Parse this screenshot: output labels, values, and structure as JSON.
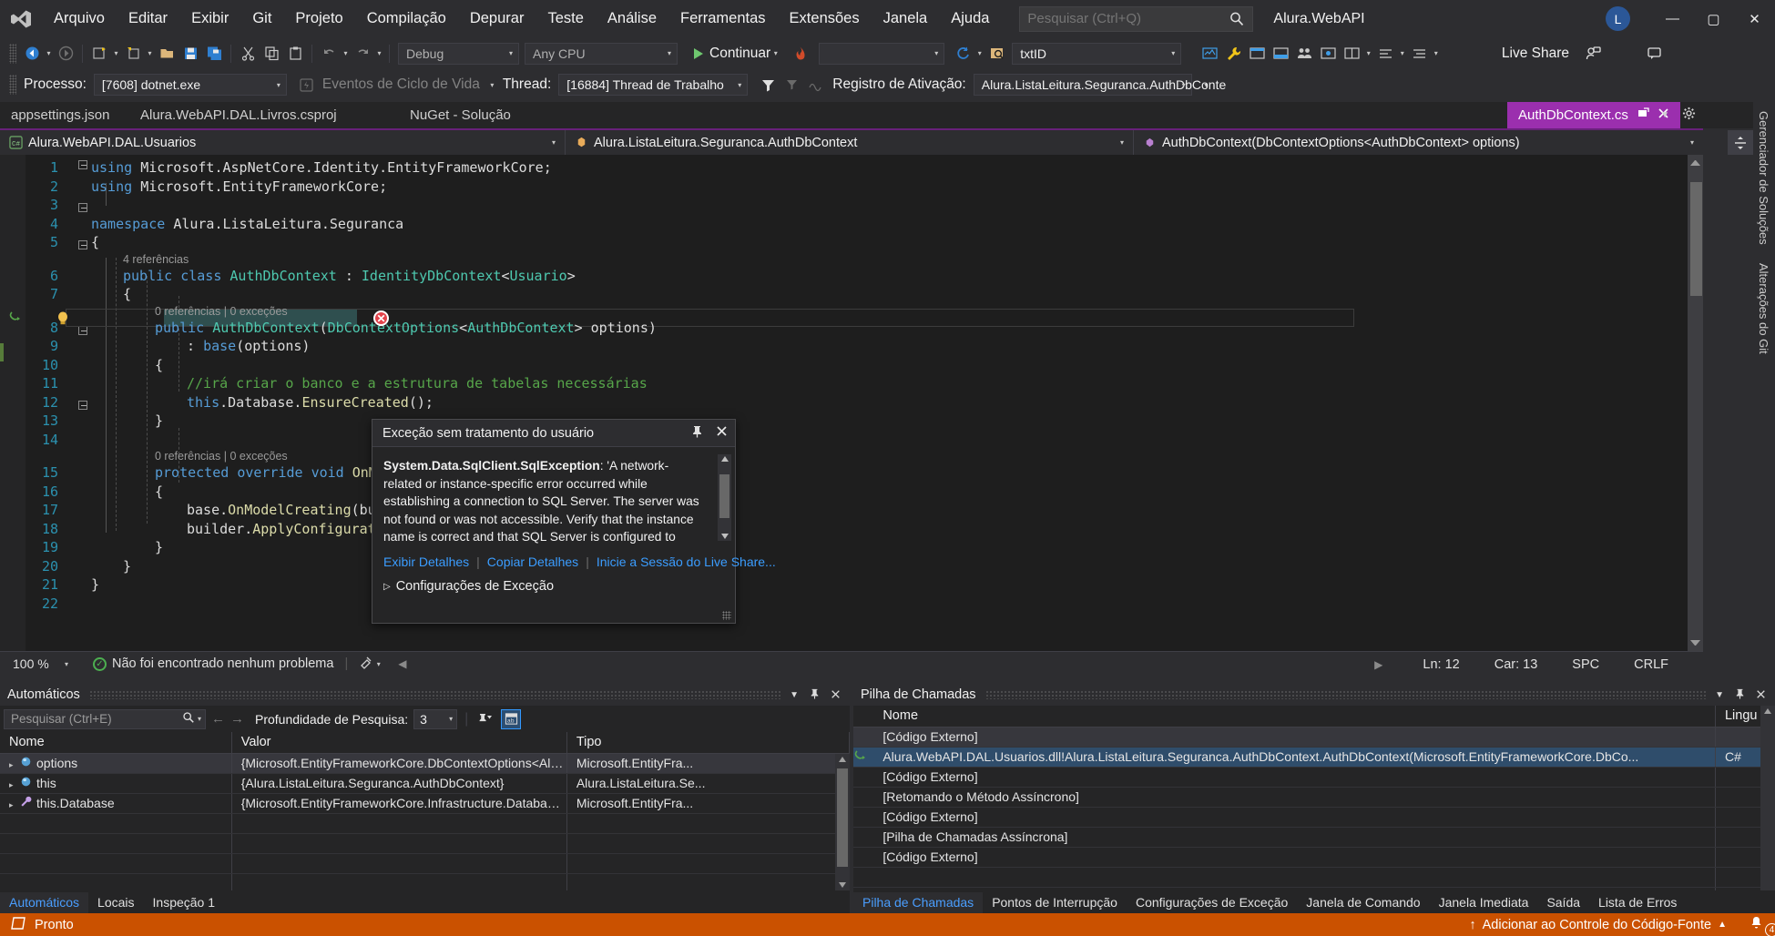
{
  "window": {
    "solution_name": "Alura.WebAPI",
    "account_initial": "L",
    "minimize": "—",
    "maximize": "▢",
    "close": "✕"
  },
  "menu": {
    "items": [
      "Arquivo",
      "Editar",
      "Exibir",
      "Git",
      "Projeto",
      "Compilação",
      "Depurar",
      "Teste",
      "Análise",
      "Ferramentas",
      "Extensões",
      "Janela",
      "Ajuda"
    ]
  },
  "search": {
    "placeholder": "Pesquisar (Ctrl+Q)",
    "value": ""
  },
  "toolbar1": {
    "config_combo": "Debug",
    "platform_combo": "Any CPU",
    "run_label": "Continuar",
    "empty_combo": "",
    "target_combo": "txtID",
    "live_share": "Live Share"
  },
  "toolbar2": {
    "process_label": "Processo:",
    "process_value": "[7608] dotnet.exe",
    "lifecycle_events": "Eventos de Ciclo de Vida",
    "thread_label": "Thread:",
    "thread_value": "[16884] Thread de Trabalho",
    "stack_frame_label": "Registro de Ativação:",
    "stack_frame_value": "Alura.ListaLeitura.Seguranca.AuthDbConte"
  },
  "doc_tabs": [
    {
      "label": "appsettings.json",
      "active": false
    },
    {
      "label": "Alura.WebAPI.DAL.Livros.csproj",
      "active": false
    },
    {
      "label": "NuGet - Solução",
      "active": false
    },
    {
      "label": "AuthDbContext.cs",
      "active": true
    }
  ],
  "navbar": {
    "project": "Alura.WebAPI.DAL.Usuarios",
    "type": "Alura.ListaLeitura.Seguranca.AuthDbContext",
    "member": "AuthDbContext(DbContextOptions<AuthDbContext> options)"
  },
  "code": {
    "lines": [
      {
        "n": 1,
        "tokens": [
          [
            "kw",
            "using "
          ],
          [
            "plain",
            "Microsoft.AspNetCore.Identity.EntityFrameworkCore;"
          ]
        ],
        "indent": 0
      },
      {
        "n": 2,
        "tokens": [
          [
            "kw",
            "using "
          ],
          [
            "plain",
            "Microsoft.EntityFrameworkCore;"
          ]
        ],
        "indent": 0
      },
      {
        "n": 3,
        "tokens": [],
        "indent": 0
      },
      {
        "n": 4,
        "tokens": [
          [
            "kw",
            "namespace "
          ],
          [
            "plain",
            "Alura.ListaLeitura.Seguranca"
          ]
        ],
        "indent": 0
      },
      {
        "n": 5,
        "tokens": [
          [
            "plain",
            "{"
          ]
        ],
        "indent": 0
      },
      {
        "n": 6,
        "tokens": [
          [
            "kw",
            "public "
          ],
          [
            "kw",
            "class "
          ],
          [
            "typ",
            "AuthDbContext"
          ],
          [
            "plain",
            " : "
          ],
          [
            "typ",
            "IdentityDbContext"
          ],
          [
            "plain",
            "<"
          ],
          [
            "typ",
            "Usuario"
          ],
          [
            "plain",
            ">"
          ]
        ],
        "indent": 1,
        "lens": "4 referências"
      },
      {
        "n": 7,
        "tokens": [
          [
            "plain",
            "{"
          ]
        ],
        "indent": 1
      },
      {
        "n": 8,
        "tokens": [
          [
            "kw",
            "public "
          ],
          [
            "typ",
            "AuthDbContext"
          ],
          [
            "plain",
            "("
          ],
          [
            "typ",
            "DbContextOptions"
          ],
          [
            "plain",
            "<"
          ],
          [
            "typ",
            "AuthDbContext"
          ],
          [
            "plain",
            "> options)"
          ]
        ],
        "indent": 2,
        "lens": "0 referências | 0 exceções"
      },
      {
        "n": 9,
        "tokens": [
          [
            "plain",
            ": "
          ],
          [
            "kw",
            "base"
          ],
          [
            "plain",
            "(options)"
          ]
        ],
        "indent": 3
      },
      {
        "n": 10,
        "tokens": [
          [
            "plain",
            "{"
          ]
        ],
        "indent": 2
      },
      {
        "n": 11,
        "tokens": [
          [
            "cmt",
            "//irá criar o banco e a estrutura de tabelas necessárias"
          ]
        ],
        "indent": 3
      },
      {
        "n": 12,
        "tokens": [
          [
            "kw",
            "this"
          ],
          [
            "plain",
            ".Database."
          ],
          [
            "mth",
            "EnsureCreated"
          ],
          [
            "plain",
            "();"
          ]
        ],
        "indent": 3,
        "current": true
      },
      {
        "n": 13,
        "tokens": [
          [
            "plain",
            "}"
          ]
        ],
        "indent": 2
      },
      {
        "n": 14,
        "tokens": [],
        "indent": 0
      },
      {
        "n": 15,
        "tokens": [
          [
            "kw",
            "protected "
          ],
          [
            "kw",
            "override "
          ],
          [
            "kw",
            "void "
          ],
          [
            "mth",
            "OnModelCrea"
          ]
        ],
        "indent": 2,
        "lens": "0 referências | 0 exceções",
        "clipped": true
      },
      {
        "n": 16,
        "tokens": [
          [
            "plain",
            "{"
          ]
        ],
        "indent": 2
      },
      {
        "n": 17,
        "tokens": [
          [
            "plain",
            "base."
          ],
          [
            "mth",
            "OnModelCreating"
          ],
          [
            "plain",
            "(builder);"
          ]
        ],
        "indent": 3
      },
      {
        "n": 18,
        "tokens": [
          [
            "plain",
            "builder."
          ],
          [
            "mth",
            "ApplyConfiguration"
          ],
          [
            "plain",
            "<"
          ],
          [
            "typ",
            "Usua"
          ]
        ],
        "indent": 3,
        "clipped": true
      },
      {
        "n": 19,
        "tokens": [
          [
            "plain",
            "}"
          ]
        ],
        "indent": 2
      },
      {
        "n": 20,
        "tokens": [
          [
            "plain",
            "}"
          ]
        ],
        "indent": 1
      },
      {
        "n": 21,
        "tokens": [
          [
            "plain",
            "}"
          ]
        ],
        "indent": 0
      },
      {
        "n": 22,
        "tokens": [],
        "indent": 0
      }
    ]
  },
  "exception": {
    "title": "Exceção sem tratamento do usuário",
    "type": "System.Data.SqlClient.SqlException",
    "message": ": 'A network-related or instance-specific error occurred while establishing a connection to SQL Server. The server was not found or was not accessible. Verify that the instance name is correct and that SQL Server is configured to allow remote connections. (provider: SQL Network Interfaces,",
    "links": [
      "Exibir Detalhes",
      "Copiar Detalhes",
      "Inicie a Sessão do Live Share..."
    ],
    "settings_label": "Configurações de Exceção",
    "pin_icon": "pin",
    "close_icon": "✕"
  },
  "editor_status": {
    "zoom": "100 %",
    "problems": "Não foi encontrado nenhum problema",
    "line": "Ln: 12",
    "column": "Car: 13",
    "spaces": "SPC",
    "eol": "CRLF"
  },
  "right_tabs": [
    "Gerenciador de Soluções",
    "Alterações do Git"
  ],
  "autos": {
    "title": "Automáticos",
    "search_placeholder": "Pesquisar (Ctrl+E)",
    "depth_label": "Profundidade de Pesquisa:",
    "depth_value": "3",
    "columns": [
      "Nome",
      "Valor",
      "Tipo"
    ],
    "rows": [
      {
        "name": "options",
        "value": "{Microsoft.EntityFrameworkCore.DbContextOptions<Alura.ListaL...",
        "type": "Microsoft.EntityFra...",
        "icon": "field-icon",
        "selected": true
      },
      {
        "name": "this",
        "value": "{Alura.ListaLeitura.Seguranca.AuthDbContext}",
        "type": "Alura.ListaLeitura.Se...",
        "icon": "field-icon",
        "selected": false
      },
      {
        "name": "this.Database",
        "value": "{Microsoft.EntityFrameworkCore.Infrastructure.DatabaseFacade}",
        "type": "Microsoft.EntityFra...",
        "icon": "property-icon",
        "selected": false
      }
    ],
    "tabs": [
      "Automáticos",
      "Locais",
      "Inspeção 1"
    ],
    "active_tab": "Automáticos"
  },
  "callstack": {
    "title": "Pilha de Chamadas",
    "columns": [
      "Nome",
      "Lingu"
    ],
    "rows": [
      {
        "name": "[Código Externo]",
        "lang": "",
        "state": "selected"
      },
      {
        "name": "Alura.WebAPI.DAL.Usuarios.dll!Alura.ListaLeitura.Seguranca.AuthDbContext.AuthDbContext(Microsoft.EntityFrameworkCore.DbCo...",
        "lang": "C#",
        "state": "current"
      },
      {
        "name": "[Código Externo]",
        "lang": "",
        "state": "dim"
      },
      {
        "name": "[Retomando o Método Assíncrono]",
        "lang": "",
        "state": "dim"
      },
      {
        "name": "[Código Externo]",
        "lang": "",
        "state": "dim"
      },
      {
        "name": "[Pilha de Chamadas Assíncrona]",
        "lang": "",
        "state": "dim"
      },
      {
        "name": "[Código Externo]",
        "lang": "",
        "state": "dim"
      }
    ],
    "tabs": [
      "Pilha de Chamadas",
      "Pontos de Interrupção",
      "Configurações de Exceção",
      "Janela de Comando",
      "Janela Imediata",
      "Saída",
      "Lista de Erros"
    ],
    "active_tab": "Pilha de Chamadas"
  },
  "statusbar": {
    "ready": "Pronto",
    "source_control": "Adicionar ao Controle do Código-Fonte",
    "notification_count": "4"
  },
  "colors": {
    "accent_tab": "#9b2fae",
    "status_orange": "#ca5100",
    "editor_bg": "#1e1e1e",
    "chrome_bg": "#2d2d30",
    "panel_bg": "#252526",
    "link_blue": "#3b9dff",
    "keyword_blue": "#569cd6",
    "type_teal": "#4ec9b0",
    "comment_green": "#57a64a",
    "error_red": "#e2434b"
  }
}
